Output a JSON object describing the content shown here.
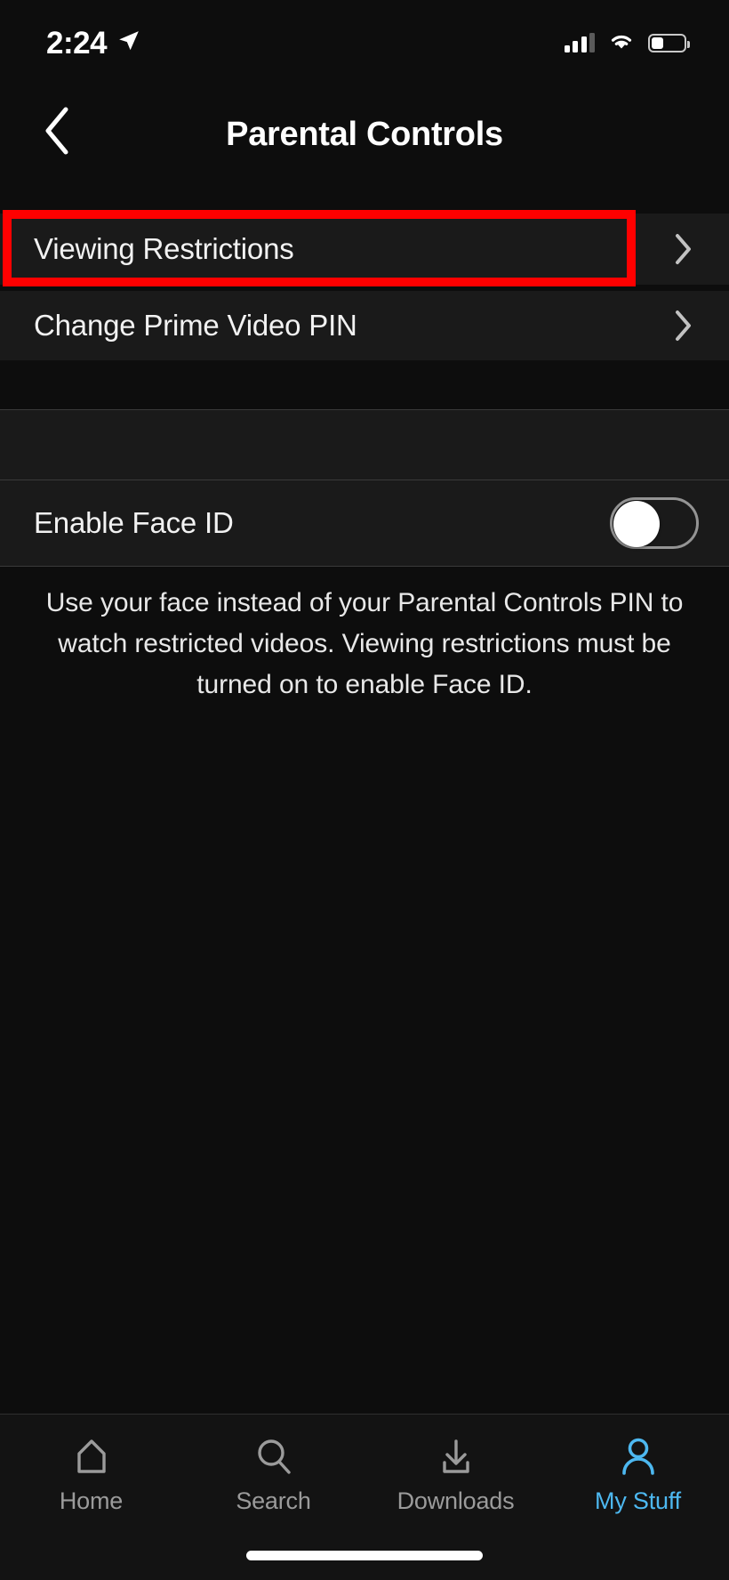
{
  "status_bar": {
    "time": "2:24",
    "location_icon": "location-arrow-icon",
    "signal_icon": "cellular-signal-icon",
    "signal_bars_filled": 3,
    "signal_bars_total": 4,
    "wifi_icon": "wifi-icon",
    "battery_icon": "battery-icon",
    "battery_level_percent": 35
  },
  "header": {
    "back_icon": "chevron-left-icon",
    "title": "Parental Controls"
  },
  "settings_rows": [
    {
      "label": "Viewing Restrictions",
      "accessory": "chevron-right-icon",
      "highlighted": true
    },
    {
      "label": "Change Prime Video PIN",
      "accessory": "chevron-right-icon",
      "highlighted": false
    }
  ],
  "face_id": {
    "label": "Enable Face ID",
    "toggle_state": "off",
    "description": "Use your face instead of your Parental Controls PIN to watch restricted videos. Viewing restrictions must be turned on to enable Face ID."
  },
  "highlight": {
    "color": "#ff0000",
    "target": "Viewing Restrictions"
  },
  "tab_bar": {
    "items": [
      {
        "label": "Home",
        "icon": "home-icon",
        "active": false
      },
      {
        "label": "Search",
        "icon": "search-icon",
        "active": false
      },
      {
        "label": "Downloads",
        "icon": "download-icon",
        "active": false
      },
      {
        "label": "My Stuff",
        "icon": "person-icon",
        "active": true
      }
    ],
    "active_color": "#4db8f0",
    "inactive_color": "#9b9b9b"
  }
}
